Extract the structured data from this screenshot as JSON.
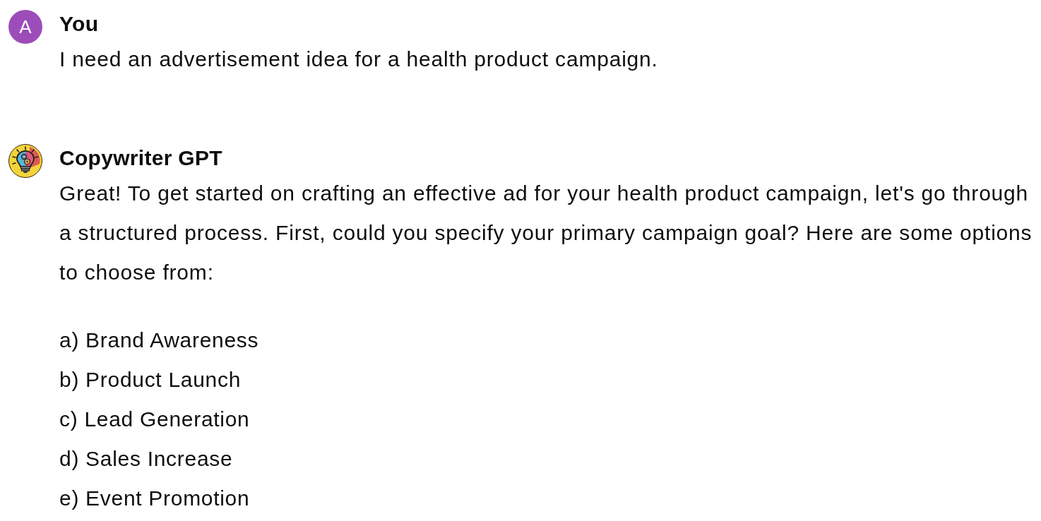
{
  "messages": [
    {
      "author": "You",
      "avatar": {
        "kind": "letter",
        "letter": "A"
      },
      "paragraphs": [
        "I need an advertisement idea for a health product campaign."
      ]
    },
    {
      "author": "Copywriter GPT",
      "avatar": {
        "kind": "bulb"
      },
      "paragraphs": [
        "Great! To get started on crafting an effective ad for your health product campaign, let's go through a structured process. First, could you specify your primary campaign goal? Here are some options to choose from:"
      ],
      "options": [
        "a) Brand Awareness",
        "b) Product Launch",
        "c) Lead Generation",
        "d) Sales Increase",
        "e) Event Promotion"
      ]
    }
  ]
}
